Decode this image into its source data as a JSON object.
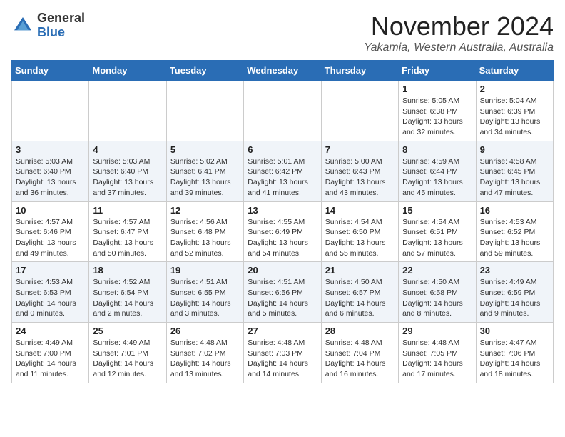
{
  "header": {
    "logo_general": "General",
    "logo_blue": "Blue",
    "month_title": "November 2024",
    "location": "Yakamia, Western Australia, Australia"
  },
  "days_of_week": [
    "Sunday",
    "Monday",
    "Tuesday",
    "Wednesday",
    "Thursday",
    "Friday",
    "Saturday"
  ],
  "weeks": [
    [
      {
        "day": "",
        "empty": true
      },
      {
        "day": "",
        "empty": true
      },
      {
        "day": "",
        "empty": true
      },
      {
        "day": "",
        "empty": true
      },
      {
        "day": "",
        "empty": true
      },
      {
        "day": "1",
        "sunrise": "5:05 AM",
        "sunset": "6:38 PM",
        "daylight": "13 hours and 32 minutes."
      },
      {
        "day": "2",
        "sunrise": "5:04 AM",
        "sunset": "6:39 PM",
        "daylight": "13 hours and 34 minutes."
      }
    ],
    [
      {
        "day": "3",
        "sunrise": "5:03 AM",
        "sunset": "6:40 PM",
        "daylight": "13 hours and 36 minutes."
      },
      {
        "day": "4",
        "sunrise": "5:03 AM",
        "sunset": "6:40 PM",
        "daylight": "13 hours and 37 minutes."
      },
      {
        "day": "5",
        "sunrise": "5:02 AM",
        "sunset": "6:41 PM",
        "daylight": "13 hours and 39 minutes."
      },
      {
        "day": "6",
        "sunrise": "5:01 AM",
        "sunset": "6:42 PM",
        "daylight": "13 hours and 41 minutes."
      },
      {
        "day": "7",
        "sunrise": "5:00 AM",
        "sunset": "6:43 PM",
        "daylight": "13 hours and 43 minutes."
      },
      {
        "day": "8",
        "sunrise": "4:59 AM",
        "sunset": "6:44 PM",
        "daylight": "13 hours and 45 minutes."
      },
      {
        "day": "9",
        "sunrise": "4:58 AM",
        "sunset": "6:45 PM",
        "daylight": "13 hours and 47 minutes."
      }
    ],
    [
      {
        "day": "10",
        "sunrise": "4:57 AM",
        "sunset": "6:46 PM",
        "daylight": "13 hours and 49 minutes."
      },
      {
        "day": "11",
        "sunrise": "4:57 AM",
        "sunset": "6:47 PM",
        "daylight": "13 hours and 50 minutes."
      },
      {
        "day": "12",
        "sunrise": "4:56 AM",
        "sunset": "6:48 PM",
        "daylight": "13 hours and 52 minutes."
      },
      {
        "day": "13",
        "sunrise": "4:55 AM",
        "sunset": "6:49 PM",
        "daylight": "13 hours and 54 minutes."
      },
      {
        "day": "14",
        "sunrise": "4:54 AM",
        "sunset": "6:50 PM",
        "daylight": "13 hours and 55 minutes."
      },
      {
        "day": "15",
        "sunrise": "4:54 AM",
        "sunset": "6:51 PM",
        "daylight": "13 hours and 57 minutes."
      },
      {
        "day": "16",
        "sunrise": "4:53 AM",
        "sunset": "6:52 PM",
        "daylight": "13 hours and 59 minutes."
      }
    ],
    [
      {
        "day": "17",
        "sunrise": "4:53 AM",
        "sunset": "6:53 PM",
        "daylight": "14 hours and 0 minutes."
      },
      {
        "day": "18",
        "sunrise": "4:52 AM",
        "sunset": "6:54 PM",
        "daylight": "14 hours and 2 minutes."
      },
      {
        "day": "19",
        "sunrise": "4:51 AM",
        "sunset": "6:55 PM",
        "daylight": "14 hours and 3 minutes."
      },
      {
        "day": "20",
        "sunrise": "4:51 AM",
        "sunset": "6:56 PM",
        "daylight": "14 hours and 5 minutes."
      },
      {
        "day": "21",
        "sunrise": "4:50 AM",
        "sunset": "6:57 PM",
        "daylight": "14 hours and 6 minutes."
      },
      {
        "day": "22",
        "sunrise": "4:50 AM",
        "sunset": "6:58 PM",
        "daylight": "14 hours and 8 minutes."
      },
      {
        "day": "23",
        "sunrise": "4:49 AM",
        "sunset": "6:59 PM",
        "daylight": "14 hours and 9 minutes."
      }
    ],
    [
      {
        "day": "24",
        "sunrise": "4:49 AM",
        "sunset": "7:00 PM",
        "daylight": "14 hours and 11 minutes."
      },
      {
        "day": "25",
        "sunrise": "4:49 AM",
        "sunset": "7:01 PM",
        "daylight": "14 hours and 12 minutes."
      },
      {
        "day": "26",
        "sunrise": "4:48 AM",
        "sunset": "7:02 PM",
        "daylight": "14 hours and 13 minutes."
      },
      {
        "day": "27",
        "sunrise": "4:48 AM",
        "sunset": "7:03 PM",
        "daylight": "14 hours and 14 minutes."
      },
      {
        "day": "28",
        "sunrise": "4:48 AM",
        "sunset": "7:04 PM",
        "daylight": "14 hours and 16 minutes."
      },
      {
        "day": "29",
        "sunrise": "4:48 AM",
        "sunset": "7:05 PM",
        "daylight": "14 hours and 17 minutes."
      },
      {
        "day": "30",
        "sunrise": "4:47 AM",
        "sunset": "7:06 PM",
        "daylight": "14 hours and 18 minutes."
      }
    ]
  ]
}
